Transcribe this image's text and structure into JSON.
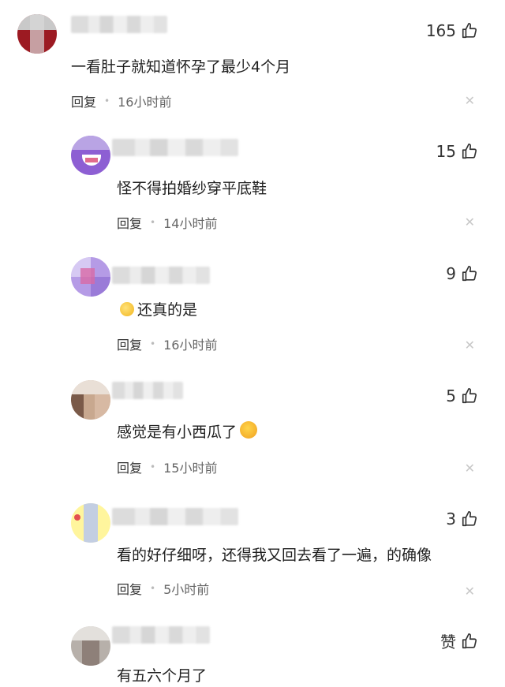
{
  "comments": [
    {
      "likes": "165",
      "text": "一看肚子就知道怀孕了最少4个月",
      "reply": "回复",
      "time": "16小时前"
    },
    {
      "likes": "15",
      "text": "怪不得拍婚纱穿平底鞋",
      "reply": "回复",
      "time": "14小时前"
    },
    {
      "likes": "9",
      "text": "还真的是",
      "reply": "回复",
      "time": "16小时前"
    },
    {
      "likes": "5",
      "text": "感觉是有小西瓜了",
      "reply": "回复",
      "time": "15小时前"
    },
    {
      "likes": "3",
      "text": "看的好仔细呀，还得我又回去看了一遍，的确像",
      "reply": "回复",
      "time": "5小时前"
    },
    {
      "likes": "赞",
      "text": "有五六个月了"
    }
  ],
  "icons": {
    "like": "thumbs-up-icon",
    "close": "close-icon",
    "emoji_lemon": "lemon-emoji-icon",
    "emoji_laugh": "laughing-emoji-icon"
  },
  "colors": {
    "text": "#1f1f1f",
    "meta": "#666666",
    "close": "#c8c8c8"
  }
}
